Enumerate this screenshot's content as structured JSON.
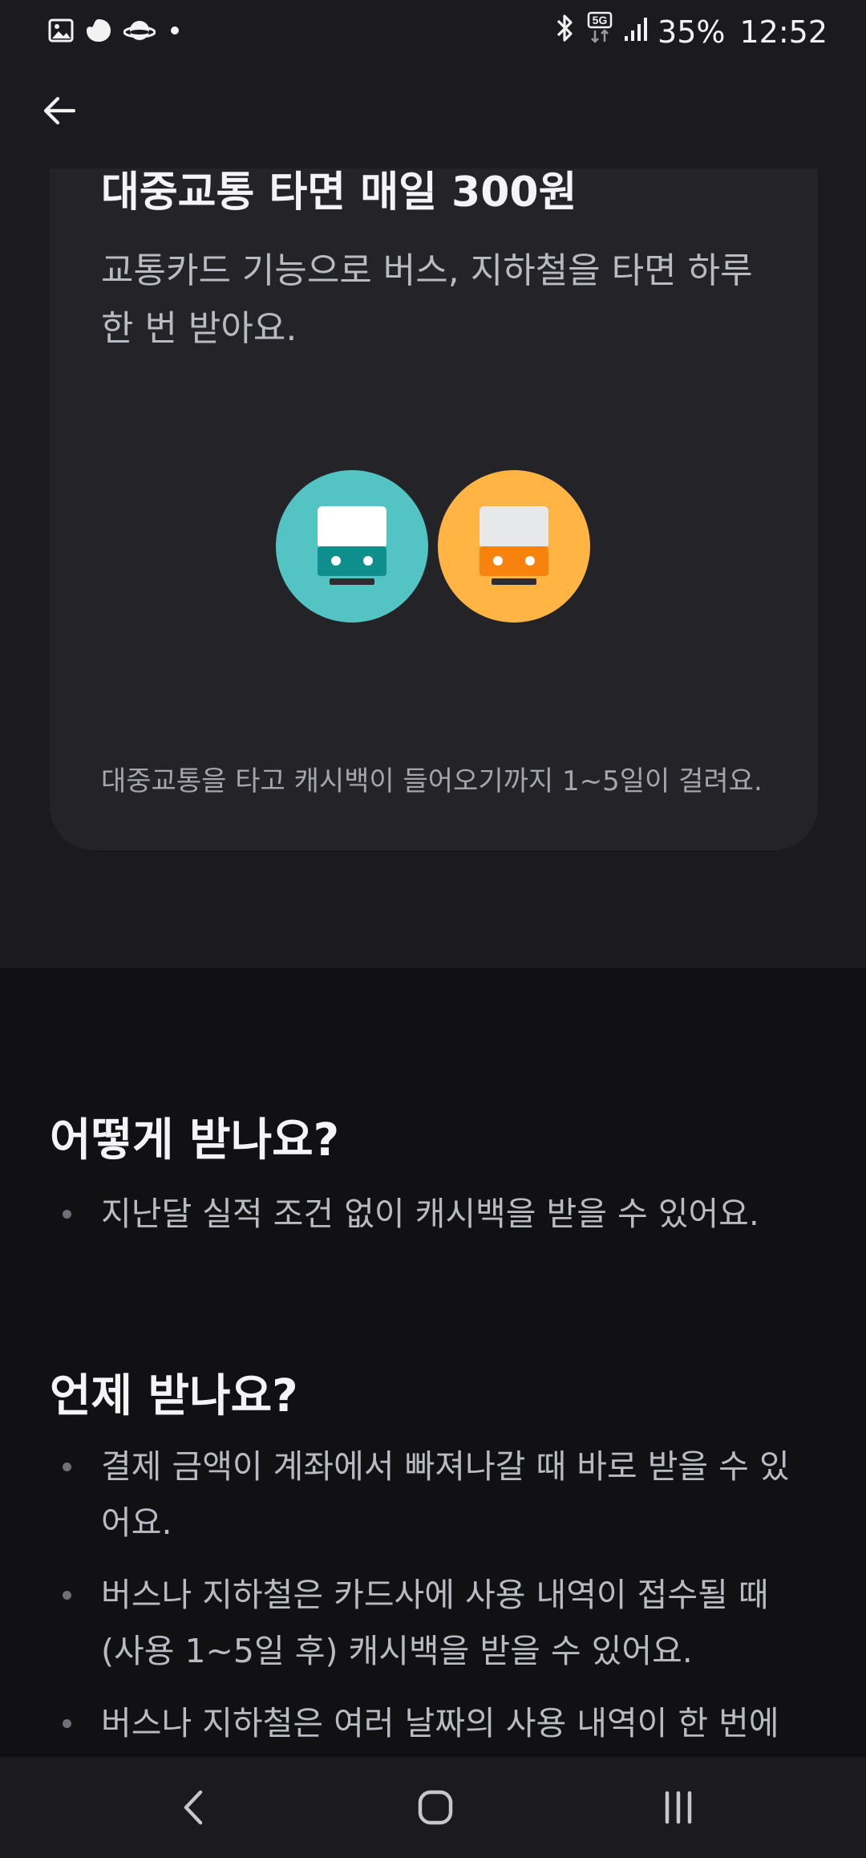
{
  "status_bar": {
    "battery": "35%",
    "time": "12:52",
    "network": "5G",
    "left_icons": [
      "gallery-icon",
      "app-notification-icon",
      "planet-icon",
      "dot-icon"
    ],
    "right_icons": [
      "bluetooth-icon",
      "5g-icon",
      "signal-icon"
    ]
  },
  "app_bar": {
    "back_icon": "arrow-left-icon"
  },
  "card": {
    "title": "대중교통 타면 매일 300원",
    "description": "교통카드 기능으로 버스, 지하철을 타면 하루 한 번 받아요.",
    "note": "대중교통을 타고 캐시백이 들어오기까지 1~5일이 걸려요.",
    "illustration": {
      "icons": [
        "bus-teal-icon",
        "subway-orange-icon"
      ],
      "colors": {
        "teal": "#54C3C3",
        "orange": "#FFB444"
      }
    }
  },
  "sections": [
    {
      "title": "어떻게 받나요?",
      "items": [
        "지난달 실적 조건 없이 캐시백을 받을 수 있어요."
      ]
    },
    {
      "title": "언제 받나요?",
      "items": [
        "결제 금액이 계좌에서 빠져나갈 때 바로 받을 수 있어요.",
        "버스나 지하철은 카드사에 사용 내역이 접수될 때 (사용 1~5일 후) 캐시백을 받을 수 있어요.",
        "버스나 지하철은 여러 날짜의 사용 내역이 한 번에"
      ]
    }
  ],
  "nav_bar": {
    "buttons": [
      "back-nav-icon",
      "home-nav-icon",
      "recents-nav-icon"
    ]
  }
}
